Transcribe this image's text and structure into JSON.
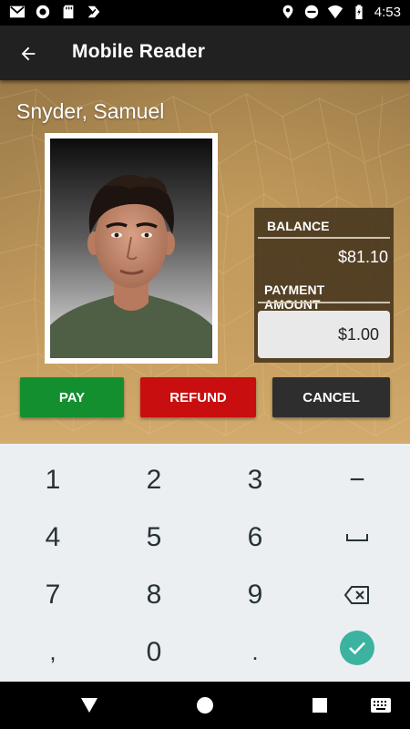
{
  "status_bar": {
    "time": "4:53",
    "left_icons": [
      "gmail-icon",
      "record-icon",
      "sd-card-icon",
      "task-icon"
    ],
    "right_icons": [
      "location-icon",
      "do-not-disturb-icon",
      "wifi-icon",
      "battery-icon"
    ]
  },
  "app_bar": {
    "title": "Mobile Reader",
    "back_icon": "arrow-back-icon"
  },
  "profile": {
    "name": "Snyder, Samuel"
  },
  "account": {
    "balance_label": "BALANCE",
    "balance_value": "$81.10",
    "payment_label": "PAYMENT AMOUNT",
    "payment_value": "$1.00"
  },
  "actions": {
    "pay": "PAY",
    "refund": "REFUND",
    "cancel": "CANCEL",
    "colors": {
      "pay": "#138f2f",
      "refund": "#c80e0e",
      "cancel": "#2e2e2e"
    }
  },
  "keyboard": {
    "row1": [
      "1",
      "2",
      "3",
      "−"
    ],
    "row2": [
      "4",
      "5",
      "6"
    ],
    "row3": [
      "7",
      "8",
      "9"
    ],
    "row4": [
      ",",
      "0",
      "."
    ],
    "space_icon": "space-icon",
    "backspace_icon": "backspace-icon",
    "done_icon": "check-icon",
    "accent": "#3bb3a0"
  },
  "nav_bar": {
    "icons": [
      "back-triangle-icon",
      "home-circle-icon",
      "recents-square-icon",
      "keyboard-icon"
    ]
  }
}
